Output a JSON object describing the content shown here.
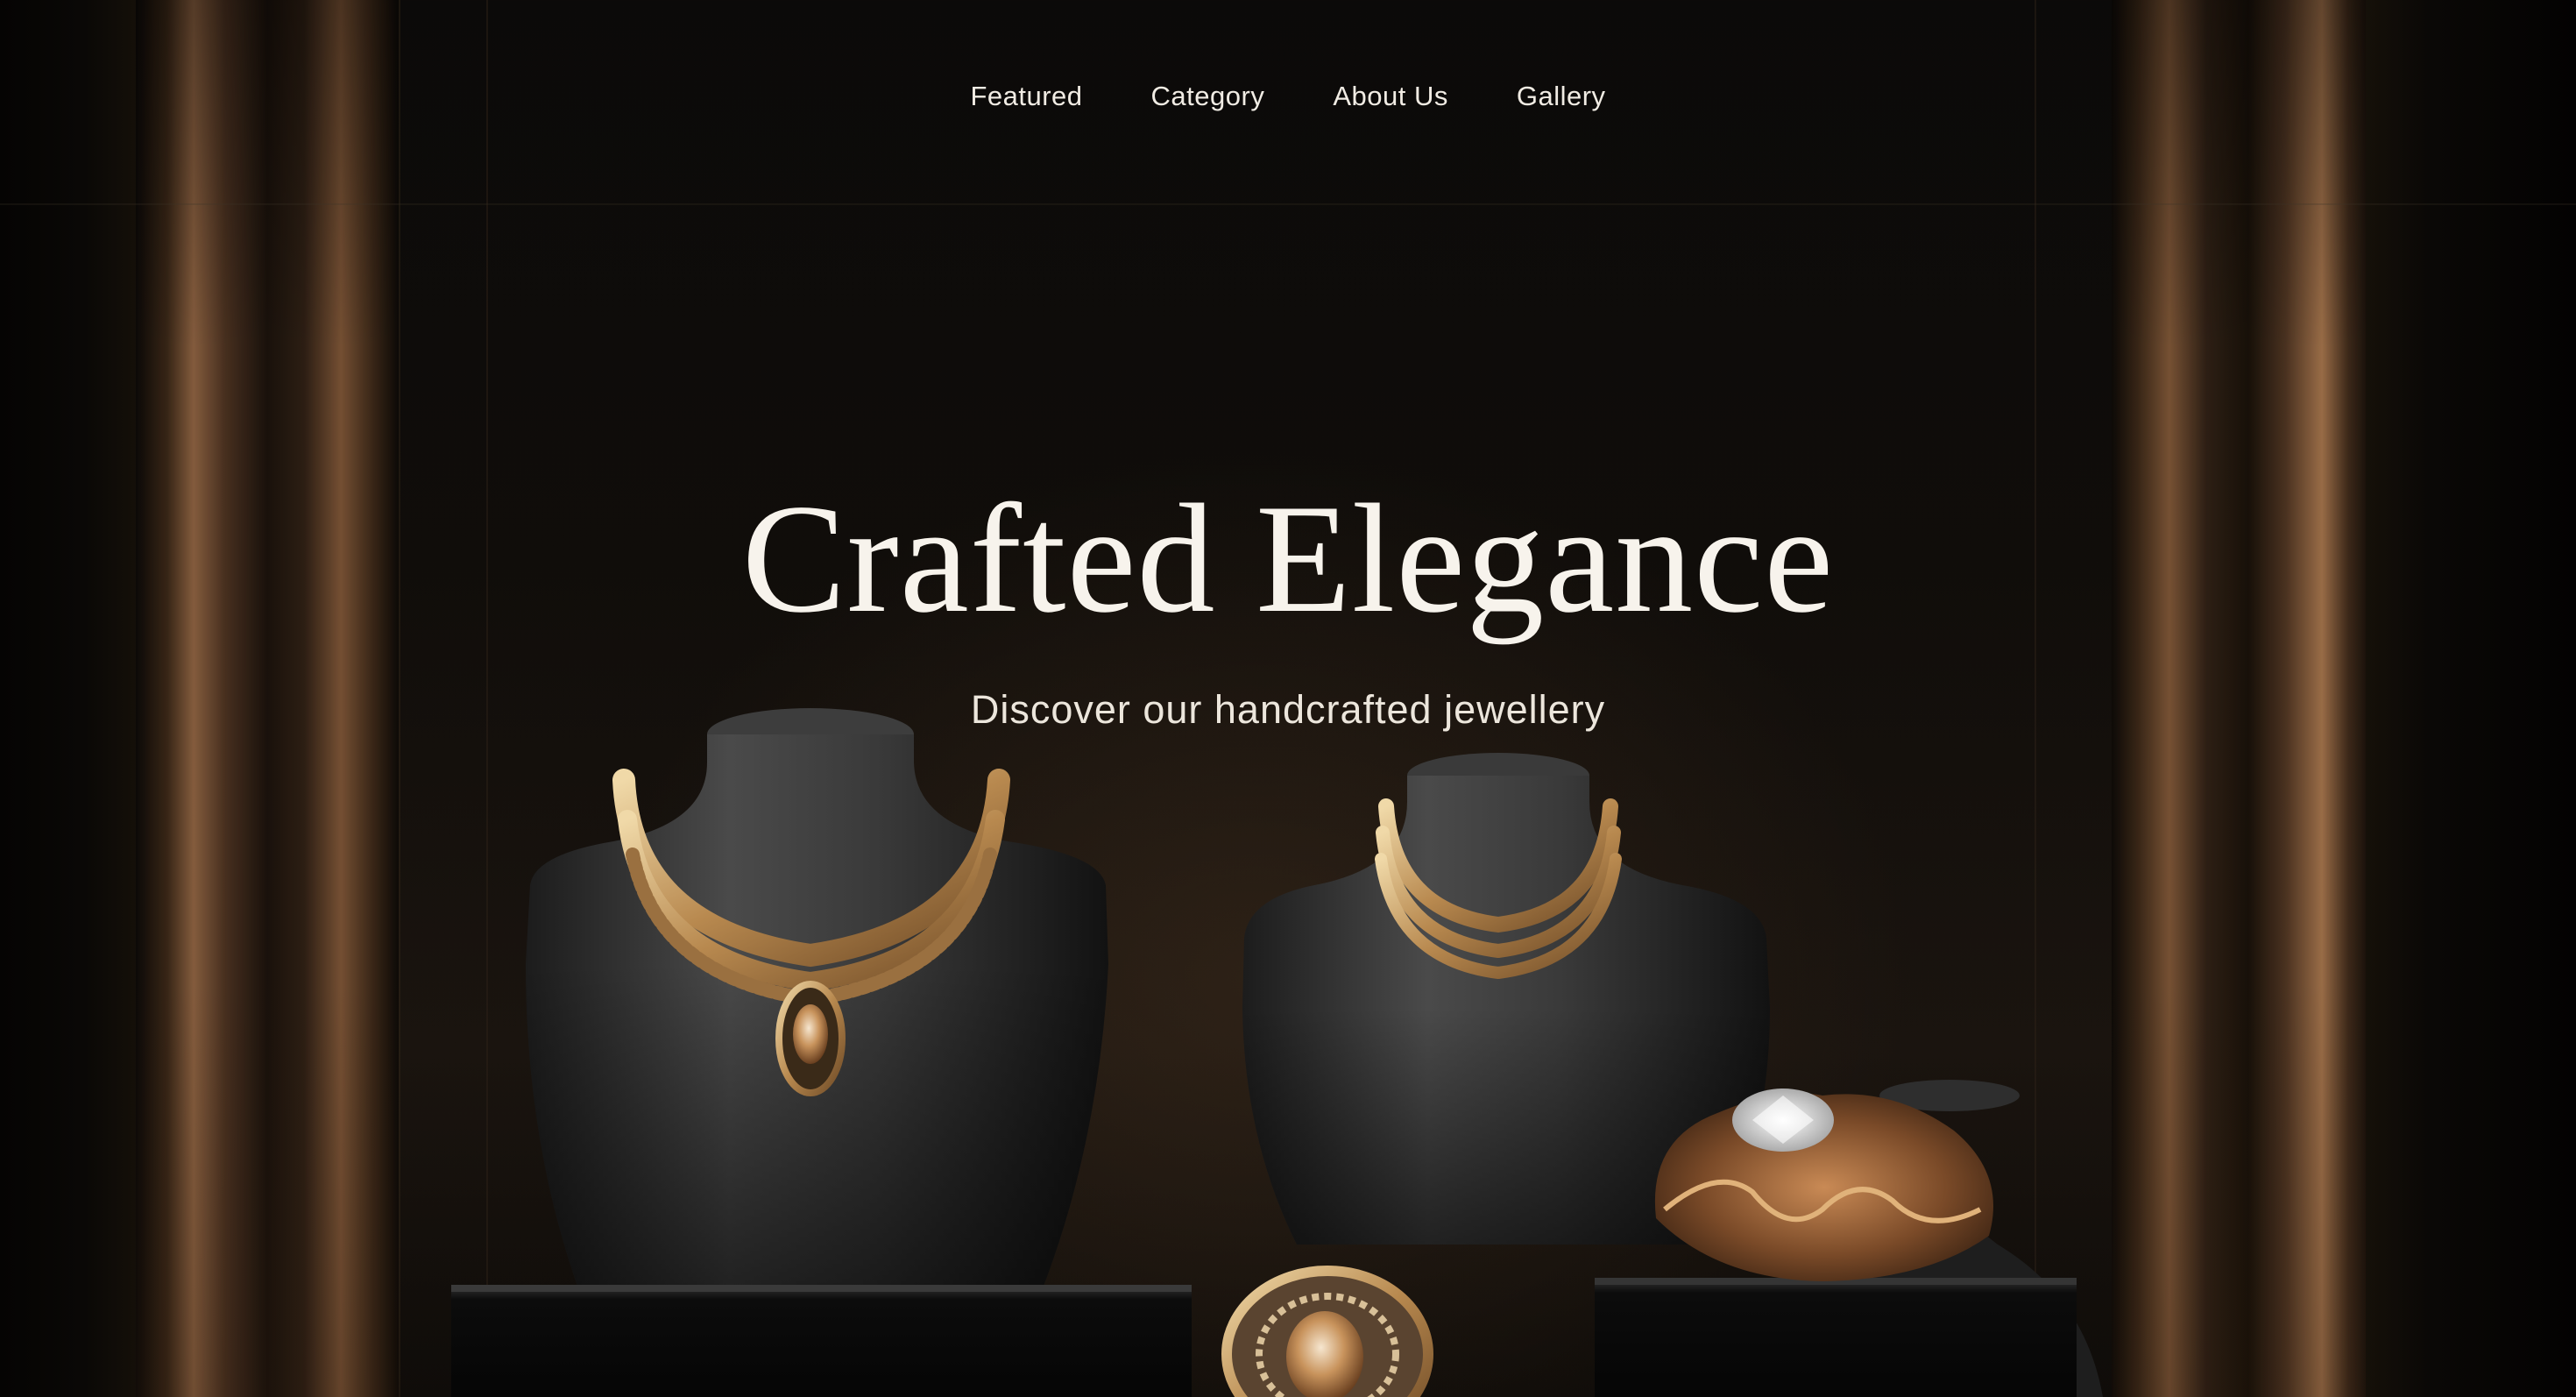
{
  "nav": {
    "items": [
      {
        "label": "Featured"
      },
      {
        "label": "Category"
      },
      {
        "label": "About Us"
      },
      {
        "label": "Gallery"
      }
    ]
  },
  "hero": {
    "title": "Crafted Elegance",
    "subtitle": "Discover our handcrafted jewellery"
  },
  "colors": {
    "background": "#0a0908",
    "text": "#f7f3ec",
    "accent_gold": "#c9a46a",
    "accent_copper": "#8a6040"
  }
}
